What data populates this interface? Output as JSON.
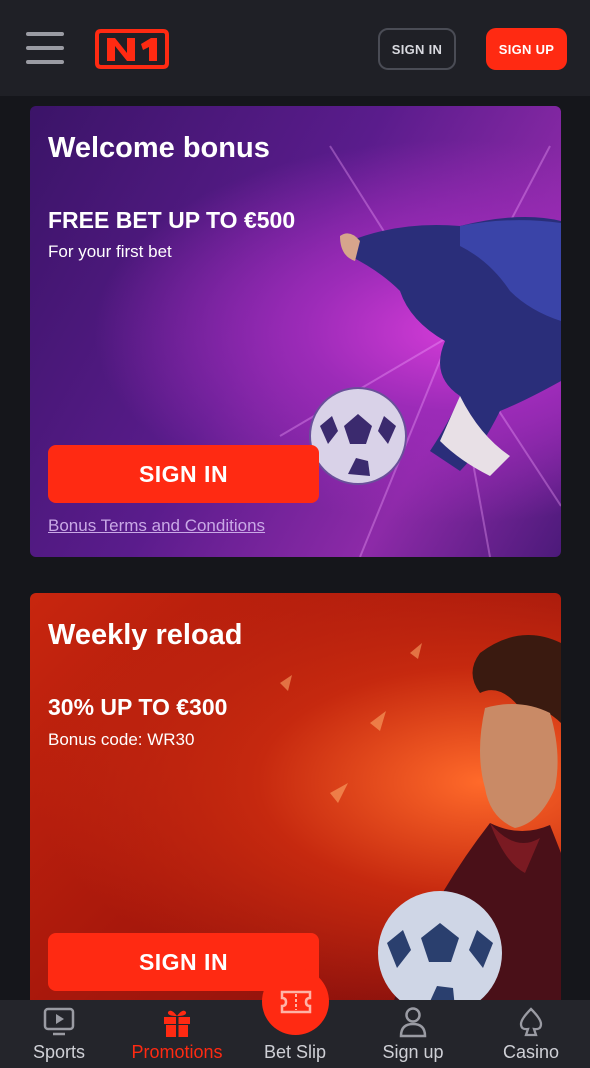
{
  "header": {
    "menu_icon": "hamburger-icon",
    "logo_text": "N1",
    "signin_label": "SIGN IN",
    "signup_label": "SIGN UP"
  },
  "promos": [
    {
      "title": "Welcome bonus",
      "headline": "FREE BET UP TO €500",
      "description": "For your first bet",
      "button_label": "SIGN IN",
      "link_label": "Bonus Terms and Conditions"
    },
    {
      "title": "Weekly reload",
      "headline": "30% UP TO €300",
      "description": "Bonus code: WR30",
      "button_label": "SIGN IN"
    }
  ],
  "bottom_nav": {
    "items": [
      {
        "label": "Sports",
        "icon": "tv-icon",
        "active": false
      },
      {
        "label": "Promotions",
        "icon": "gift-icon",
        "active": true
      },
      {
        "label": "Bet Slip",
        "icon": "ticket-icon",
        "active": false
      },
      {
        "label": "Sign up",
        "icon": "user-icon",
        "active": false
      },
      {
        "label": "Casino",
        "icon": "spade-icon",
        "active": false
      }
    ]
  },
  "colors": {
    "accent": "#ff2a12",
    "header_bg": "#1f2026",
    "page_bg": "#15161b",
    "nav_bg": "#24252b"
  }
}
